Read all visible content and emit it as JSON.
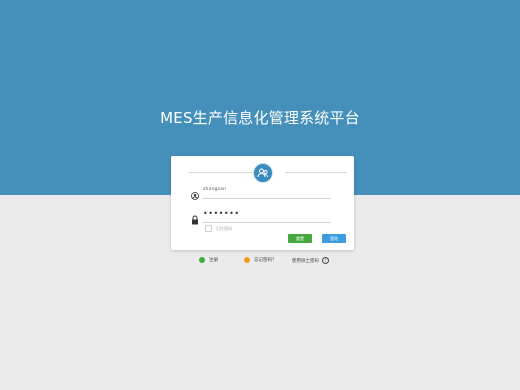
{
  "page": {
    "title": "MES生产信息化管理系统平台"
  },
  "login": {
    "username_value": "zhangsan",
    "password_mask": "•••••••",
    "remember_label": "记住密码",
    "reset_label": "重置",
    "login_label": "登陆"
  },
  "footer": {
    "register_label": "注册",
    "forgot_label": "忘记密码？",
    "help_label": "使用除土密码",
    "help_icon_glyph": "?"
  },
  "colors": {
    "header_bg": "#4590ba",
    "page_bg": "#ebebeb",
    "reset_button": "#46a83a",
    "login_button": "#3d9be0",
    "register_dot": "#3fae3b",
    "forgot_dot": "#f39a1f"
  }
}
